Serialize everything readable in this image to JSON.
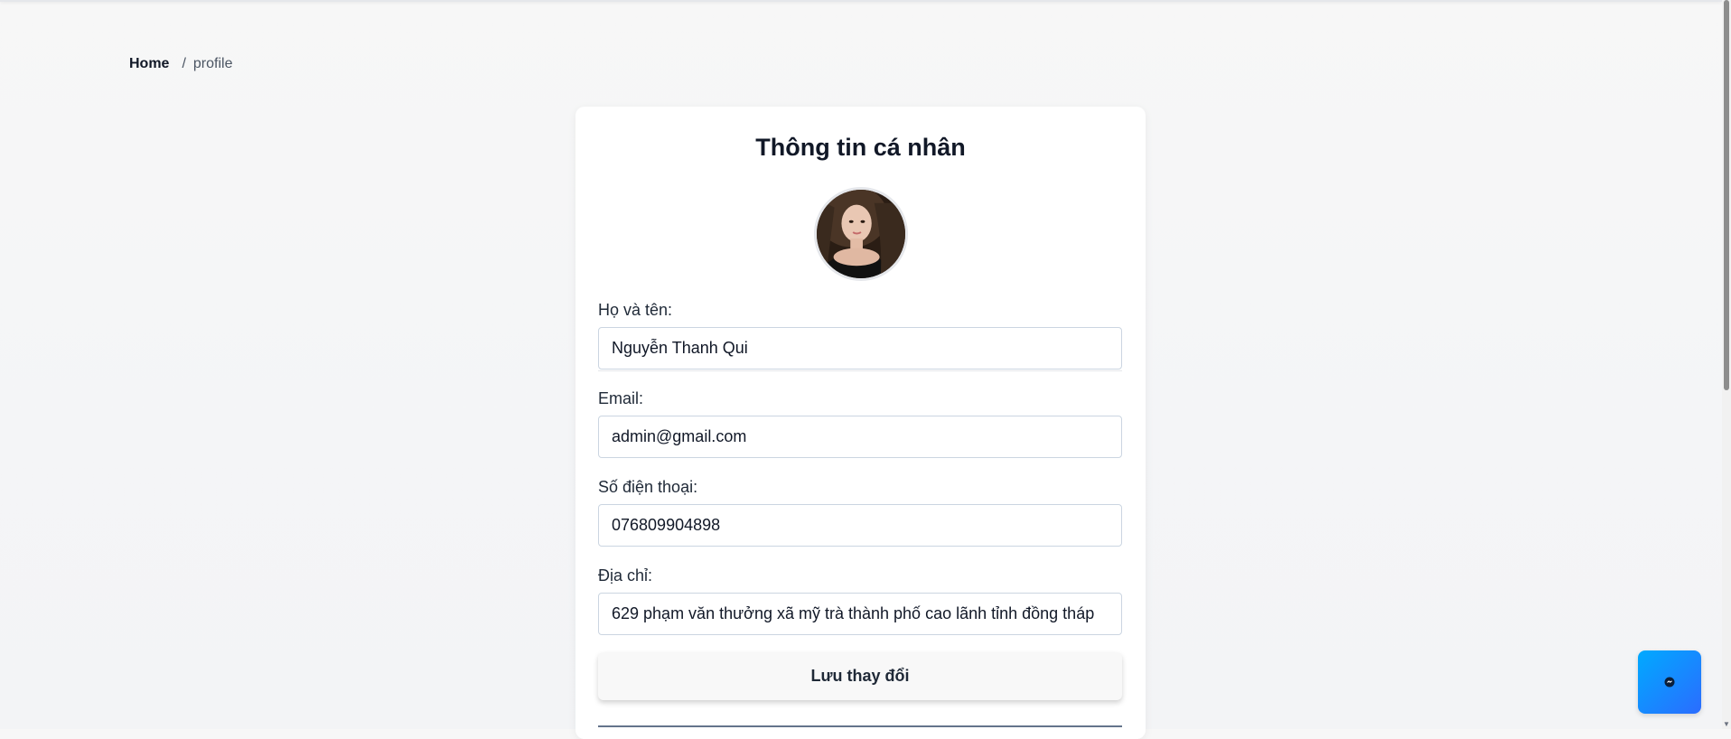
{
  "breadcrumb": {
    "home": "Home",
    "separator": "/",
    "current": "profile"
  },
  "card": {
    "title": "Thông tin cá nhân",
    "fields": {
      "name": {
        "label": "Họ và tên:",
        "value": "Nguyễn Thanh Qui"
      },
      "email": {
        "label": "Email:",
        "value": "admin@gmail.com"
      },
      "phone": {
        "label": "Số điện thoại:",
        "value": "076809904898"
      },
      "address": {
        "label": "Địa chỉ:",
        "value": "629 phạm văn thưởng xã mỹ trà thành phố cao lãnh tỉnh đồng tháp"
      }
    },
    "save_label": "Lưu thay đổi"
  },
  "icons": {
    "avatar": "user-photo",
    "chat": "chat-icon"
  },
  "colors": {
    "title": "#111827",
    "chat_gradient_start": "#00aaff",
    "chat_gradient_end": "#2b6cff"
  }
}
